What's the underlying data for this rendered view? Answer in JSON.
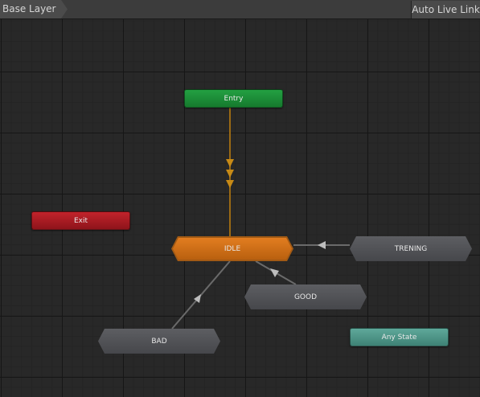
{
  "toolbar": {
    "breadcrumb": "Base Layer",
    "live_link_label": "Auto Live Link"
  },
  "nodes": {
    "entry": "Entry",
    "exit": "Exit",
    "any_state": "Any State",
    "idle": "IDLE",
    "trening": "TRENING",
    "good": "GOOD",
    "bad": "BAD"
  },
  "colors": {
    "entry": "#1e8e3a",
    "exit": "#b01c24",
    "any_state": "#4e9589",
    "default_state": "#d8731b",
    "state": "#55565a",
    "default_transition": "#9b6a14",
    "transition": "#6a6a6a"
  },
  "transitions": [
    {
      "from": "Entry",
      "to": "IDLE"
    },
    {
      "from": "TRENING",
      "to": "IDLE"
    },
    {
      "from": "GOOD",
      "to": "IDLE"
    },
    {
      "from": "BAD",
      "to": "IDLE"
    }
  ]
}
